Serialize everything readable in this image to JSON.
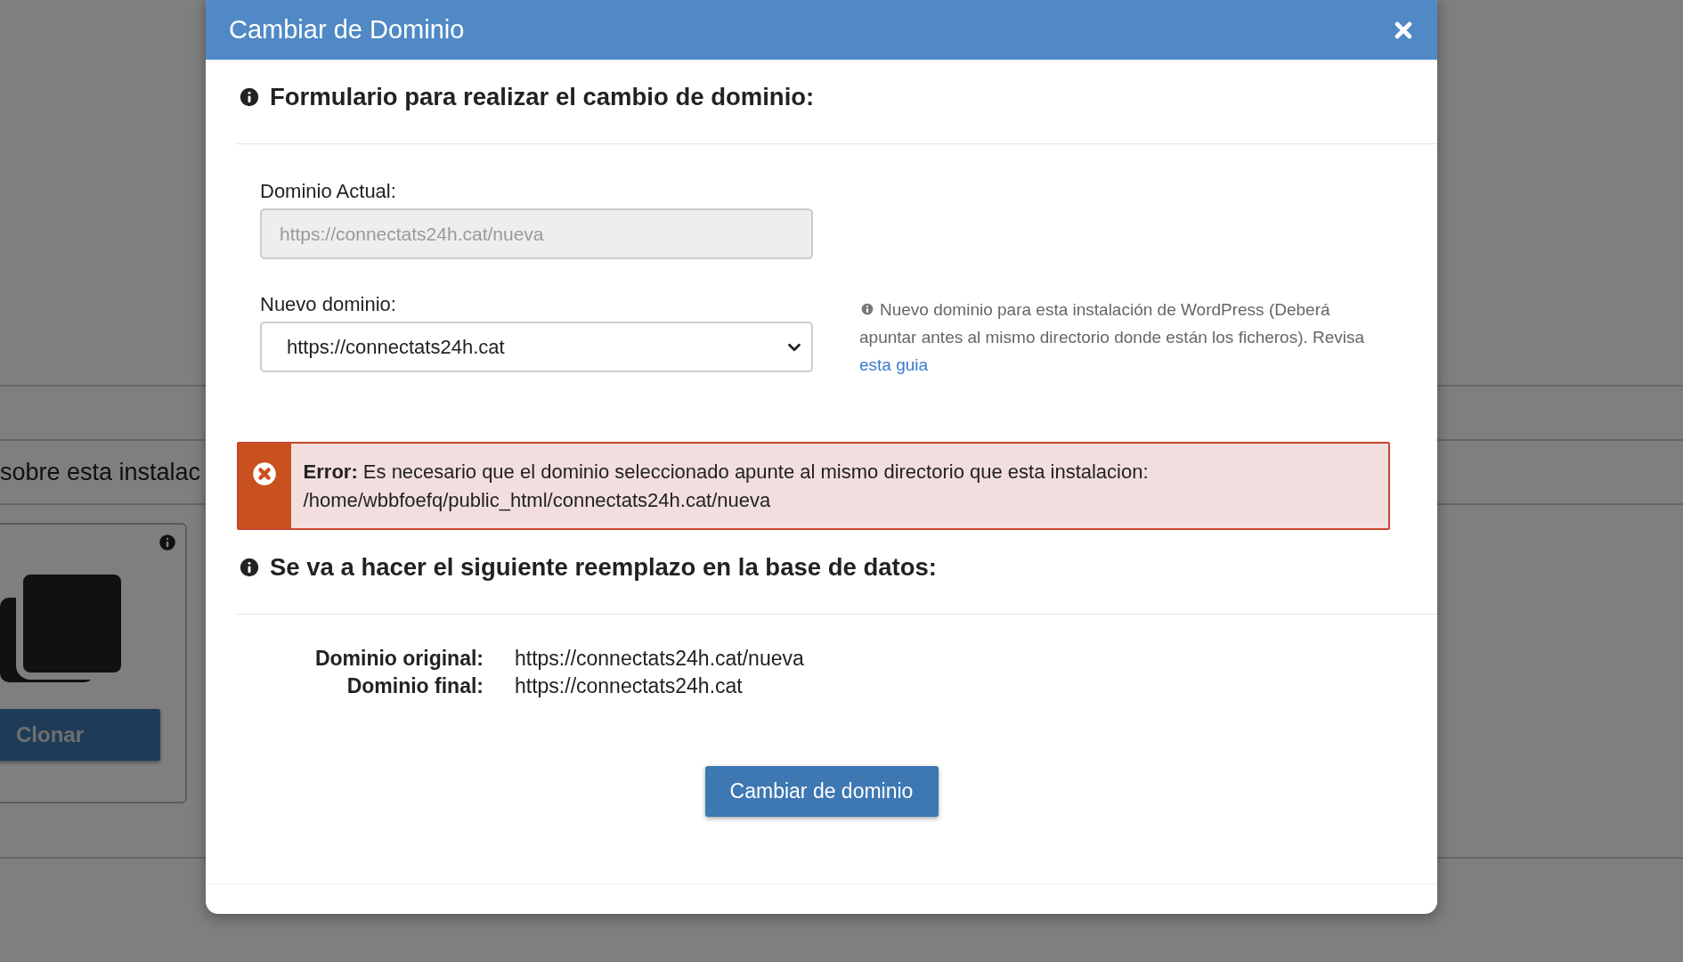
{
  "background": {
    "section_title": "sobre esta instalac",
    "card": {
      "button": "Clonar"
    }
  },
  "dialog": {
    "title": "Cambiar de Dominio",
    "form": {
      "heading": "Formulario para realizar el cambio de dominio:",
      "fields": [
        {
          "kind": "text",
          "label": "Dominio Actual:",
          "value": "https://connectats24h.cat/nueva",
          "disabled": true
        },
        {
          "kind": "select",
          "label": "Nuevo dominio:",
          "value": "https://connectats24h.cat",
          "disabled": false
        }
      ],
      "help": {
        "text": "Nuevo dominio para esta instalación de WordPress (Deberá apuntar antes al mismo directorio donde están los ficheros). Revisa",
        "link": "esta guia"
      },
      "error": {
        "message": "**Error:** Es necesario que el dominio seleccionado apunte al mismo directorio que esta instalacion: /home/wbbfoefq/public_html/connectats24h.cat/nueva"
      }
    },
    "replacement": {
      "heading": "Se va a hacer el siguiente reemplazo en la base de datos:",
      "rows": [
        {
          "label": "Dominio original:",
          "value": "https://connectats24h.cat/nueva"
        },
        {
          "label": "Dominio final:",
          "value": "https://connectats24h.cat"
        }
      ]
    },
    "submit": "Cambiar de dominio"
  }
}
